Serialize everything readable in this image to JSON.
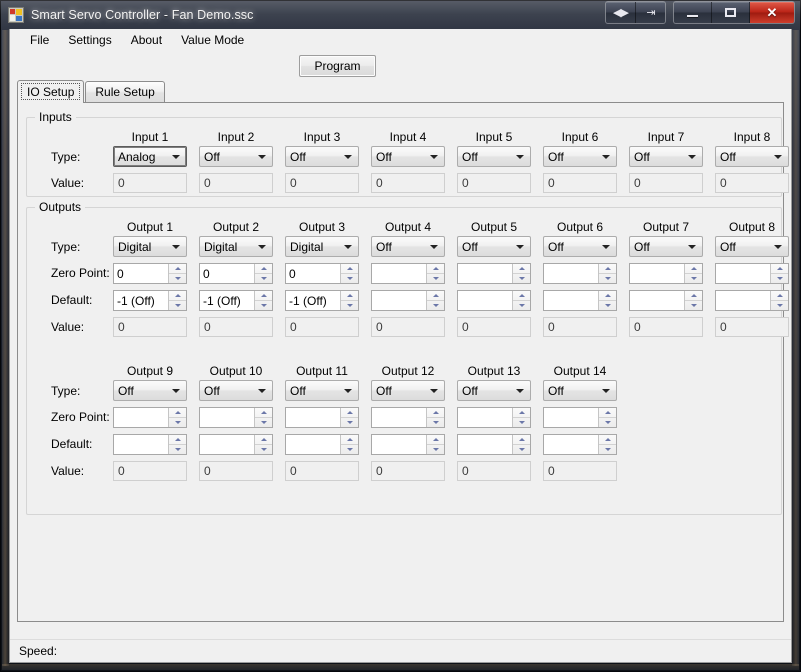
{
  "window": {
    "title": "Smart Servo Controller - Fan Demo.ssc",
    "icon": "app-icon",
    "controls": {
      "restore_left_right": "◀▶",
      "export": "⇥",
      "minimize": "minimize",
      "maximize": "maximize",
      "close": "✕"
    }
  },
  "menu": {
    "items": [
      {
        "label": "File"
      },
      {
        "label": "Settings"
      },
      {
        "label": "About"
      },
      {
        "label": "Value Mode"
      }
    ]
  },
  "toolbar": {
    "program_label": "Program"
  },
  "tabs": [
    {
      "label": "IO Setup",
      "active": true
    },
    {
      "label": "Rule Setup",
      "active": false
    }
  ],
  "inputs_group": {
    "title": "Inputs",
    "row_labels": {
      "type": "Type:",
      "value": "Value:"
    },
    "columns": [
      {
        "header": "Input 1",
        "type": "Analog",
        "value": "0",
        "focused": true
      },
      {
        "header": "Input 2",
        "type": "Off",
        "value": "0",
        "focused": false
      },
      {
        "header": "Input 3",
        "type": "Off",
        "value": "0",
        "focused": false
      },
      {
        "header": "Input 4",
        "type": "Off",
        "value": "0",
        "focused": false
      },
      {
        "header": "Input 5",
        "type": "Off",
        "value": "0",
        "focused": false
      },
      {
        "header": "Input 6",
        "type": "Off",
        "value": "0",
        "focused": false
      },
      {
        "header": "Input 7",
        "type": "Off",
        "value": "0",
        "focused": false
      },
      {
        "header": "Input 8",
        "type": "Off",
        "value": "0",
        "focused": false
      }
    ]
  },
  "outputs_group": {
    "title": "Outputs",
    "row_labels": {
      "type": "Type:",
      "zero_point": "Zero Point:",
      "default": "Default:",
      "value": "Value:"
    },
    "row1": [
      {
        "header": "Output 1",
        "type": "Digital",
        "zero_point": "0",
        "default": "-1 (Off)",
        "value": "0"
      },
      {
        "header": "Output 2",
        "type": "Digital",
        "zero_point": "0",
        "default": "-1 (Off)",
        "value": "0"
      },
      {
        "header": "Output 3",
        "type": "Digital",
        "zero_point": "0",
        "default": "-1 (Off)",
        "value": "0"
      },
      {
        "header": "Output 4",
        "type": "Off",
        "zero_point": "",
        "default": "",
        "value": "0"
      },
      {
        "header": "Output 5",
        "type": "Off",
        "zero_point": "",
        "default": "",
        "value": "0"
      },
      {
        "header": "Output 6",
        "type": "Off",
        "zero_point": "",
        "default": "",
        "value": "0"
      },
      {
        "header": "Output 7",
        "type": "Off",
        "zero_point": "",
        "default": "",
        "value": "0"
      },
      {
        "header": "Output 8",
        "type": "Off",
        "zero_point": "",
        "default": "",
        "value": "0"
      }
    ],
    "row2": [
      {
        "header": "Output 9",
        "type": "Off",
        "zero_point": "",
        "default": "",
        "value": "0"
      },
      {
        "header": "Output 10",
        "type": "Off",
        "zero_point": "",
        "default": "",
        "value": "0"
      },
      {
        "header": "Output 11",
        "type": "Off",
        "zero_point": "",
        "default": "",
        "value": "0"
      },
      {
        "header": "Output 12",
        "type": "Off",
        "zero_point": "",
        "default": "",
        "value": "0"
      },
      {
        "header": "Output 13",
        "type": "Off",
        "zero_point": "",
        "default": "",
        "value": "0"
      },
      {
        "header": "Output 14",
        "type": "Off",
        "zero_point": "",
        "default": "",
        "value": "0"
      }
    ]
  },
  "statusbar": {
    "speed_label": "Speed:"
  },
  "colors": {
    "face": "#f0f0f0",
    "close_red": "#bb2417",
    "spinner_arrow": "#6b77a8",
    "border": "#acacac"
  }
}
